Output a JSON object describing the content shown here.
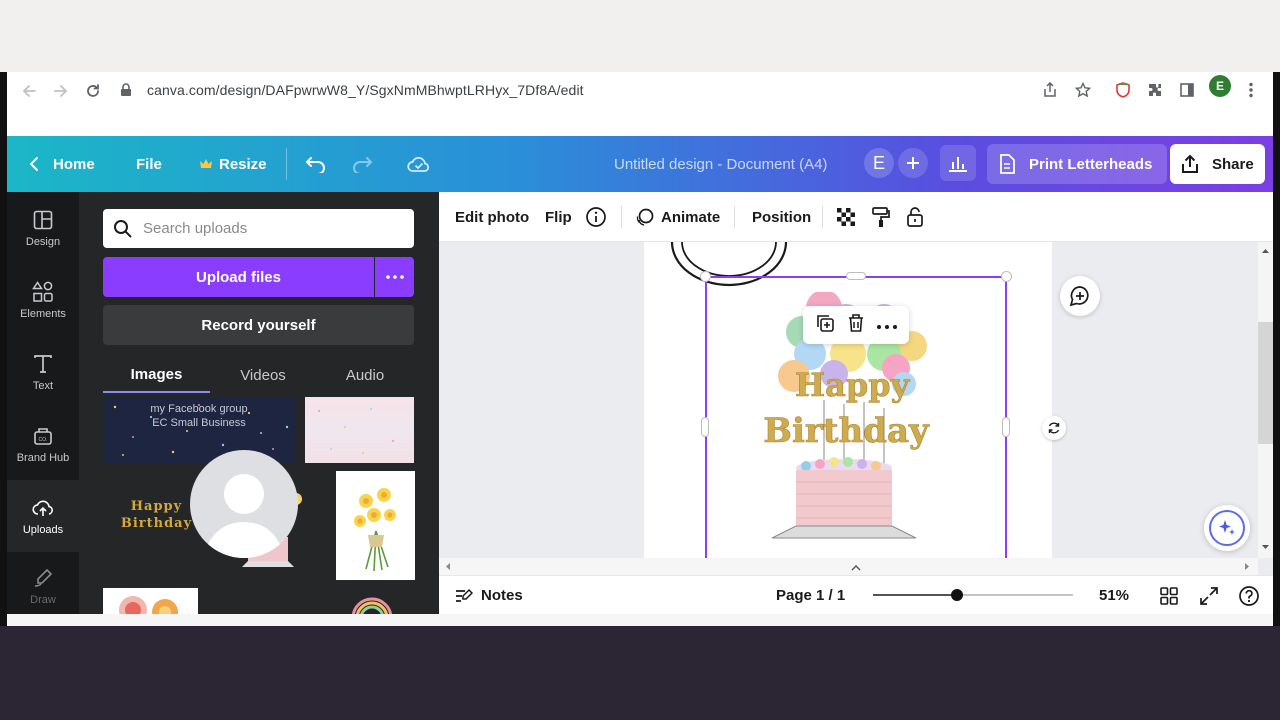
{
  "browser": {
    "url": "canva.com/design/DAFpwrwW8_Y/SgxNmMBhwptLRHyx_7Df8A/edit",
    "profile_initial": "E"
  },
  "header": {
    "home_label": "Home",
    "file_label": "File",
    "resize_label": "Resize",
    "doc_title": "Untitled design - Document (A4)",
    "team_initial": "E",
    "print_label": "Print Letterheads",
    "share_label": "Share",
    "gradient_start": "#1bb7c7",
    "gradient_end": "#7b3fe4"
  },
  "rail": {
    "items": [
      {
        "label": "Design",
        "icon": "layout-icon"
      },
      {
        "label": "Elements",
        "icon": "shapes-icon"
      },
      {
        "label": "Text",
        "icon": "text-icon"
      },
      {
        "label": "Brand Hub",
        "icon": "brand-hub-icon"
      },
      {
        "label": "Uploads",
        "icon": "cloud-upload-icon"
      },
      {
        "label": "Draw",
        "icon": "pen-icon"
      }
    ],
    "active": "Uploads"
  },
  "panel": {
    "search_placeholder": "Search uploads",
    "upload_label": "Upload files",
    "record_label": "Record yourself",
    "tabs": [
      {
        "label": "Images"
      },
      {
        "label": "Videos"
      },
      {
        "label": "Audio"
      }
    ],
    "active_tab": "Images",
    "thumb_text": {
      "facebook_line1": "my Facebook group",
      "facebook_line2": "EC Small Business",
      "birthday_line1": "Happy",
      "birthday_line2": "Birthday"
    },
    "accent_color": "#8b3dff"
  },
  "toolbar": {
    "edit_photo": "Edit photo",
    "flip": "Flip",
    "animate": "Animate",
    "position": "Position"
  },
  "canvas": {
    "cake_text_line1": "Happy",
    "cake_text_line2": "Birthday"
  },
  "bottombar": {
    "notes_label": "Notes",
    "page_label": "Page 1 / 1",
    "zoom_label": "51%",
    "zoom_fraction": 0.42
  }
}
